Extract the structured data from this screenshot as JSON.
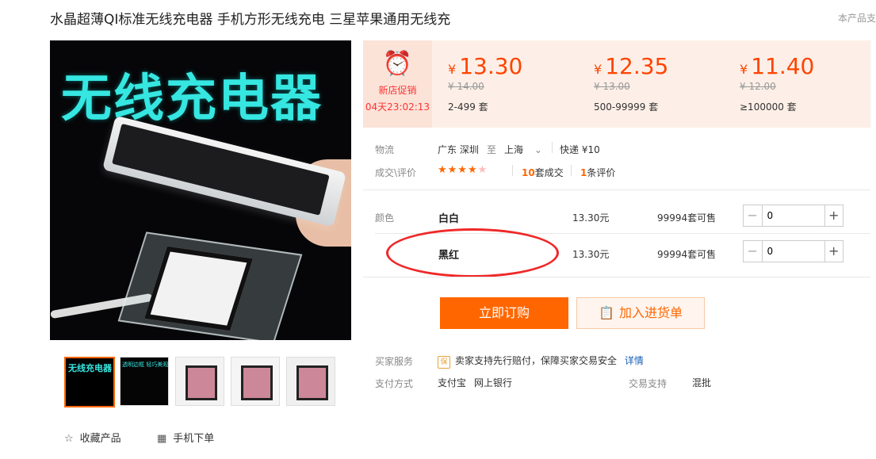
{
  "product": {
    "title": "水晶超薄QI标准无线充电器 手机方形无线充电 三星苹果通用无线充",
    "corner_text": "本产品支",
    "hero_text": "无线充电器"
  },
  "thumbnails": [
    {
      "caption": "无线充电器"
    },
    {
      "caption": "透明边框 轻巧美观"
    },
    {
      "caption": ""
    },
    {
      "caption": ""
    },
    {
      "caption": ""
    }
  ],
  "bottom_links": {
    "favorite": "收藏产品",
    "mobile": "手机下单"
  },
  "promo": {
    "label": "新店促销",
    "countdown": "04天23:02:13"
  },
  "price_tiers": [
    {
      "currency": "¥",
      "price": "13.30",
      "original": "¥ 14.00",
      "qty": "2-499 套"
    },
    {
      "currency": "¥",
      "price": "12.35",
      "original": "¥ 13.00",
      "qty": "500-99999 套"
    },
    {
      "currency": "¥",
      "price": "11.40",
      "original": "¥ 12.00",
      "qty": "≥100000 套"
    }
  ],
  "logistics": {
    "label": "物流",
    "from": "广东 深圳",
    "to_word": "至",
    "dest": "上海",
    "express": "快递 ¥10"
  },
  "deals": {
    "label": "成交\\评价",
    "rating": 4.5,
    "stars": "★★★★",
    "half_star": "★",
    "sales_count": "10",
    "sales_unit": "套成交",
    "review_count": "1",
    "review_unit": "条评价"
  },
  "sku": {
    "label": "颜色",
    "rows": [
      {
        "name": "白白",
        "price": "13.30元",
        "stock": "99994套可售",
        "qty": "0"
      },
      {
        "name": "黑红",
        "price": "13.30元",
        "stock": "99994套可售",
        "qty": "0"
      }
    ]
  },
  "buttons": {
    "buy": "立即订购",
    "cart": "加入进货单"
  },
  "services": {
    "label": "买家服务",
    "badge": "保",
    "text": "卖家支持先行赔付，保障买家交易安全",
    "link": "详情",
    "pay_label": "支付方式",
    "pay1": "支付宝",
    "pay2": "网上银行",
    "trade_label": "交易支持",
    "trade_value": "混批"
  },
  "colors": {
    "accent": "#ff6600",
    "price": "#ff4400",
    "annotation": "#f02828"
  }
}
